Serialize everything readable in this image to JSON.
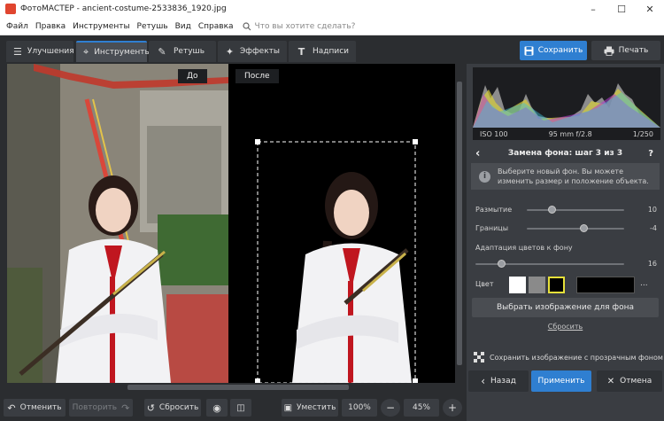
{
  "window": {
    "title": "ФотоМАСТЕР - ancient-costume-2533836_1920.jpg"
  },
  "menu": {
    "items": [
      "Файл",
      "Правка",
      "Инструменты",
      "Ретушь",
      "Вид",
      "Справка"
    ],
    "search_placeholder": "Что вы хотите сделать?"
  },
  "tabs": [
    {
      "label": "Улучшения",
      "icon": "sliders-icon"
    },
    {
      "label": "Инструменты",
      "icon": "crop-icon"
    },
    {
      "label": "Ретушь",
      "icon": "brush-icon"
    },
    {
      "label": "Эффекты",
      "icon": "magic-wand-icon"
    },
    {
      "label": "Надписи",
      "icon": "text-icon"
    }
  ],
  "actions": {
    "save": "Сохранить",
    "print": "Печать"
  },
  "preview": {
    "before_label": "До",
    "after_label": "После"
  },
  "histogram": {
    "iso": "ISO 100",
    "lens": "95 mm f/2.8",
    "shutter": "1/250"
  },
  "panel": {
    "step_title": "Замена фона: шаг 3 из 3",
    "help": "?",
    "hint": "Выберите новый фон. Вы можете изменить размер и положение объекта.",
    "sliders": [
      {
        "label": "Размытие",
        "value": "10",
        "fraction": 0.25
      },
      {
        "label": "Границы",
        "value": "-4",
        "fraction": 0.6
      },
      {
        "label": "Адаптация цветов к фону",
        "value": "16",
        "fraction": 0.2
      }
    ],
    "color_label": "Цвет",
    "swatches": [
      "#ffffff",
      "#8a8a8a",
      "#000000",
      "#000000"
    ],
    "selected_swatch": 2,
    "more_label": "...",
    "pick_bg_button": "Выбрать изображение для фона",
    "reset_link": "Сбросить",
    "transparent_save": "Сохранить изображение с прозрачным фоном",
    "back_button": "Назад",
    "apply_button": "Применить",
    "cancel_button": "Отмена"
  },
  "bottom": {
    "undo": "Отменить",
    "redo": "Повторить",
    "reset": "Сбросить",
    "fit": "Уместить",
    "zoom_100": "100%",
    "zoom_value": "45%"
  },
  "colors": {
    "accent": "#2f7fd1",
    "panel_bg": "#3a3d42",
    "app_bg": "#2b2d30",
    "selected_swatch_border": "#e6e03a"
  }
}
